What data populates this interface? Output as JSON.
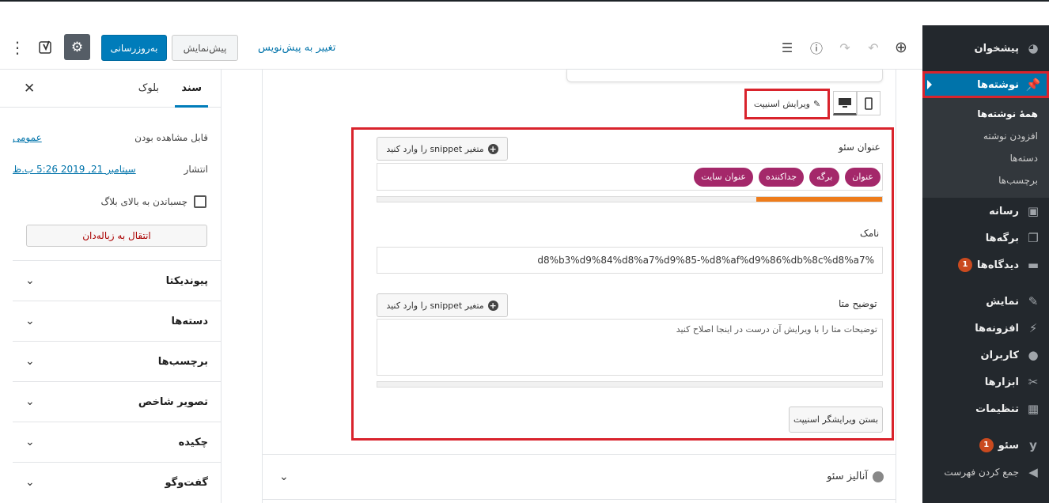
{
  "header": {
    "update_label": "به‌روزرسانی",
    "preview_label": "پیش‌نمایش",
    "switch_draft_label": "تغییر به پیش‌نویس",
    "yoast_label": "y",
    "more_icon": "⋮",
    "gear_icon": "⚙",
    "add_icon": "⊕",
    "undo_icon": "↶",
    "redo_icon": "↷",
    "info_icon": "ⓘ",
    "outline_icon": "☰"
  },
  "settings": {
    "tab_document": "سند",
    "tab_block": "بلوک",
    "close_icon": "✕",
    "visibility_label": "قابل مشاهده بودن",
    "visibility_value": "عمومی",
    "publish_label": "انتشار",
    "publish_value": "سپتامبر 21, 2019 5:26 ب.ظ",
    "stick_label": "چسباندن به بالای بلاگ",
    "trash_label": "انتقال به زباله‌دان",
    "panels": [
      "پیوندیکتا",
      "دسته‌ها",
      "برچسب‌ها",
      "تصویر شاخص",
      "چکیده",
      "گفت‌وگو"
    ]
  },
  "snippet": {
    "edit_snippet_label": "ویرایش اسنیپت",
    "seo_title_label": "عنوان سئو",
    "insert_variable_label": "متغیر snippet را وارد کنید",
    "title_pills": [
      "عنوان",
      "برگه",
      "جداکننده",
      "عنوان سایت"
    ],
    "title_progress": 0.25,
    "slug_label": "نامک",
    "slug_value": "d8%b3%d9%84%d8%a7%d9%85-%d8%af%d9%86%db%8c%d8%a7%",
    "meta_label": "توضیح متا",
    "meta_placeholder": "توضیحات متا را با ویرایش آن درست در اینجا اصلاح کنید",
    "close_editor_label": "بستن ویرایشگر اسنیپت"
  },
  "seo_analysis": {
    "label": "آنالیز سئو"
  },
  "admin_menu": {
    "dashboard": "پیشخوان",
    "posts": "نوشته‌ها",
    "posts_sub": [
      "همهٔ نوشته‌ها",
      "افزودن نوشته",
      "دسته‌ها",
      "برچسب‌ها"
    ],
    "media": "رسانه",
    "pages": "برگه‌ها",
    "comments": "دیدگاه‌ها",
    "comments_count": "1",
    "appearance": "نمایش",
    "plugins": "افزونه‌ها",
    "users": "کاربران",
    "tools": "ابزارها",
    "settings": "تنظیمات",
    "seo": "سئو",
    "seo_count": "1",
    "collapse": "جمع کردن فهرست"
  },
  "colors": {
    "primary": "#007cba",
    "admin_bg": "#23282d",
    "highlight": "#d9232c",
    "pill": "#a4286a",
    "progress": "#ee7c1b"
  }
}
